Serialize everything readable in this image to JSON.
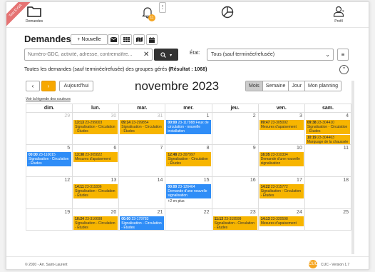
{
  "env_ribbon": "Test EVVA",
  "nav": {
    "demandes": "Demandes",
    "bell_badge": "11",
    "profil": "Profil"
  },
  "header": {
    "title": "Demandes",
    "new_button": "+ Nouvelle",
    "more_button": "⋮"
  },
  "search": {
    "placeholder": "Numéro-GDC, activité, adresse, contremaître...",
    "value": ""
  },
  "etat": {
    "label": "État:",
    "selected": "Tous (sauf terminée/refusée)"
  },
  "result": {
    "text": "Toutes les demandes (sauf terminée/refusée) des groupes gérés",
    "count": "(Résultat : 1068)"
  },
  "calendar": {
    "today_button": "Aujourd'hui",
    "month_title": "novembre 2023",
    "views": [
      "Mois",
      "Semaine",
      "Jour",
      "Mon planning"
    ],
    "active_view": "Mois",
    "legend_link": "Voir la légende des couleurs",
    "days_of_week": [
      "dim.",
      "lun.",
      "mar.",
      "mer.",
      "jeu.",
      "ven.",
      "sam."
    ],
    "weeks": [
      {
        "days": [
          {
            "num": "29",
            "muted": true,
            "events": []
          },
          {
            "num": "30",
            "muted": true,
            "events": [
              {
                "time": "13:13",
                "id": "23-299003",
                "text": "Signalisation - Circulation - Études",
                "color": "orange"
              }
            ]
          },
          {
            "num": "31",
            "muted": true,
            "events": [
              {
                "time": "09:14",
                "id": "23-299854",
                "text": "Signalisation - Circulation - Études",
                "color": "orange"
              }
            ]
          },
          {
            "num": "1",
            "muted": false,
            "events": [
              {
                "time": "00:00",
                "id": "23-117988",
                "text": "Feux de circulation - nouvelle installation",
                "color": "blue"
              }
            ]
          },
          {
            "num": "2",
            "muted": false,
            "events": []
          },
          {
            "num": "3",
            "muted": false,
            "events": [
              {
                "time": "09:47",
                "id": "23-305092",
                "text": "Mesures d'apaisement",
                "color": "orange"
              }
            ]
          },
          {
            "num": "4",
            "muted": false,
            "events": [
              {
                "time": "09:38",
                "id": "23-304410",
                "text": "Signalisation - Circulation - Études",
                "color": "orange"
              },
              {
                "time": "10:19",
                "id": "23-304463",
                "text": "Marquage de la chaussée - Nouveau",
                "color": "orange"
              }
            ]
          }
        ]
      },
      {
        "days": [
          {
            "num": "5",
            "muted": false,
            "events": [
              {
                "time": "00:00",
                "id": "23-110015",
                "text": "Signalisation - Circulation - Études",
                "color": "blue"
              }
            ]
          },
          {
            "num": "6",
            "muted": false,
            "events": [
              {
                "time": "13:38",
                "id": "23-305822",
                "text": "Mesures d'apaisement",
                "color": "orange"
              }
            ]
          },
          {
            "num": "7",
            "muted": false,
            "events": []
          },
          {
            "num": "8",
            "muted": false,
            "events": [
              {
                "time": "12:48",
                "id": "23-307997",
                "text": "Signalisation - Circulation - Études",
                "color": "orange"
              }
            ]
          },
          {
            "num": "9",
            "muted": false,
            "events": []
          },
          {
            "num": "10",
            "muted": false,
            "events": [
              {
                "time": "16:35",
                "id": "23-310334",
                "text": "Demande d'une nouvelle signalisation",
                "color": "orange"
              }
            ]
          },
          {
            "num": "11",
            "muted": false,
            "events": []
          }
        ]
      },
      {
        "days": [
          {
            "num": "12",
            "muted": false,
            "events": []
          },
          {
            "num": "13",
            "muted": false,
            "events": [
              {
                "time": "14:11",
                "id": "23-311836",
                "text": "Signalisation - Circulation - Études",
                "color": "orange"
              }
            ]
          },
          {
            "num": "14",
            "muted": false,
            "events": []
          },
          {
            "num": "15",
            "muted": false,
            "events": [
              {
                "time": "00:00",
                "id": "23-126464",
                "text": "Demande d'une nouvelle signalisation",
                "color": "blue"
              }
            ],
            "more": "+2 en plus"
          },
          {
            "num": "16",
            "muted": false,
            "events": []
          },
          {
            "num": "17",
            "muted": false,
            "events": [
              {
                "time": "14:22",
                "id": "23-315772",
                "text": "Signalisation - Circulation - Études",
                "color": "orange"
              }
            ]
          },
          {
            "num": "18",
            "muted": false,
            "events": []
          }
        ]
      },
      {
        "days": [
          {
            "num": "19",
            "muted": false,
            "events": []
          },
          {
            "num": "20",
            "muted": false,
            "events": [
              {
                "time": "10:24",
                "id": "23-316698",
                "text": "Signalisation - Circulation - Études",
                "color": "orange"
              }
            ]
          },
          {
            "num": "21",
            "muted": false,
            "events": [
              {
                "time": "00:00",
                "id": "23-179783",
                "text": "Signalisation - Circulation - Études",
                "color": "blue"
              }
            ]
          },
          {
            "num": "22",
            "muted": false,
            "events": []
          },
          {
            "num": "23",
            "muted": false,
            "events": [
              {
                "time": "11:13",
                "id": "23-319599",
                "text": "Signalisation - Circulation - Études",
                "color": "orange"
              }
            ]
          },
          {
            "num": "24",
            "muted": false,
            "events": [
              {
                "time": "14:13",
                "id": "23-320598",
                "text": "Mesures d'apaisement",
                "color": "orange"
              }
            ]
          },
          {
            "num": "25",
            "muted": false,
            "events": []
          }
        ]
      }
    ]
  },
  "footer": {
    "copyright": "© 2020 - Arr. Saint-Laurent",
    "logo_text": "CUC",
    "version": "CUC - Version 1.7"
  },
  "colors": {
    "accent": "#f7a800",
    "event_orange": "#f7b500",
    "event_blue": "#2f8df7",
    "badge": "#f5a623"
  }
}
